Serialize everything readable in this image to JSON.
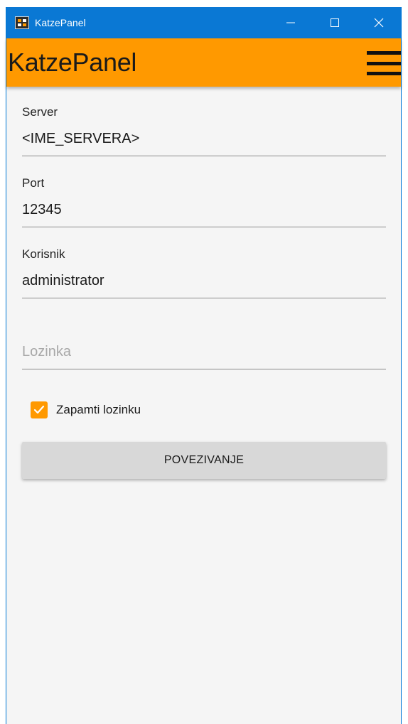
{
  "window": {
    "title": "KatzePanel"
  },
  "appbar": {
    "title": "KatzePanel",
    "menu_icon": "hamburger-menu-icon"
  },
  "form": {
    "server": {
      "label": "Server",
      "value": "<IME_SERVERA>"
    },
    "port": {
      "label": "Port",
      "value": "12345"
    },
    "user": {
      "label": "Korisnik",
      "value": "administrator"
    },
    "password": {
      "label": "",
      "value": "",
      "placeholder": "Lozinka"
    },
    "remember": {
      "label": "Zapamti lozinku",
      "checked": true
    },
    "connect_label": "POVEZIVANJE"
  },
  "colors": {
    "titlebar": "#0a78d4",
    "accent": "#ff9900",
    "button": "#d8d8d8"
  }
}
